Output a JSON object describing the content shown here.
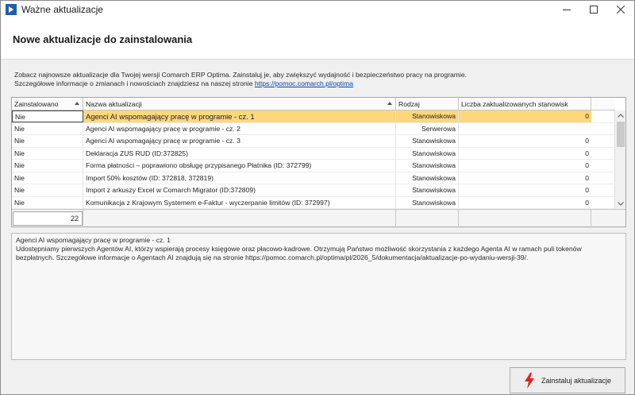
{
  "window": {
    "title": "Ważne aktualizacje",
    "controls": {
      "minimize": "minimize-icon",
      "maximize": "maximize-icon",
      "close": "close-icon"
    }
  },
  "header": {
    "title": "Nowe aktualizacje do zainstalowania"
  },
  "intro": {
    "line1": "Zobacz najnowsze aktualizacje dla Twojej wersji Comarch ERP Optima. Zainstaluj je, aby zwiększyć wydajność i bezpieczeństwo pracy na programie.",
    "line2_prefix": "Szczegółowe informacje o zmianach i nowościach znajdziesz na naszej stronie ",
    "link": "https://pomoc.comarch.pl/optima"
  },
  "grid": {
    "columns": [
      "Zainstalowano",
      "Nazwa aktualizacji",
      "Rodzaj",
      "Liczba zaktualizowanych stanowisk"
    ],
    "rows": [
      {
        "installed": "Nie",
        "name": "Agenci AI wspomagający pracę w programie - cz. 1",
        "type": "Stanowiskowa",
        "count": "0",
        "selected": true
      },
      {
        "installed": "Nie",
        "name": "Agenci AI wspomagający pracę w programie - cz. 2",
        "type": "Serwerowa",
        "count": ""
      },
      {
        "installed": "Nie",
        "name": "Agenci AI wspomagający pracę w programie - cz. 3",
        "type": "Stanowiskowa",
        "count": "0"
      },
      {
        "installed": "Nie",
        "name": "Deklaracja ZUS RUD (ID:372825)",
        "type": "Stanowiskowa",
        "count": "0"
      },
      {
        "installed": "Nie",
        "name": "Forma płatności – poprawiono obsługę przypisanego Płatnika (ID: 372799)",
        "type": "Stanowiskowa",
        "count": "0"
      },
      {
        "installed": "Nie",
        "name": "Import 50% kosztów (ID: 372818, 372819)",
        "type": "Stanowiskowa",
        "count": "0"
      },
      {
        "installed": "Nie",
        "name": "Import z arkuszy Excel w Comarch Migrator (ID:372809)",
        "type": "Stanowiskowa",
        "count": "0"
      },
      {
        "installed": "Nie",
        "name": "Komunikacja z Krajowym Systemem e-Faktur - wyczerpanie limitów (ID: 372997)",
        "type": "Stanowiskowa",
        "count": "0"
      }
    ],
    "total_count": "22"
  },
  "description": {
    "title": "Agenci AI wspomagający pracę w programie - cz. 1",
    "body": "Udostępniamy pierwszych Agentów AI, którzy wspierają procesy księgowe oraz płacowo-kadrowe. Otrzymują Państwo możliwość skorzystania z każdego Agenta AI w ramach puli tokenów bezpłatnych. Szczegółowe informacje o Agentach AI znajdują się na stronie https://pomoc.comarch.pl/optima/pl/2026_5/dokumentacja/aktualizacje-po-wydaniu-wersji-39/."
  },
  "footer": {
    "install_label": "Zainstaluj aktualizacje",
    "install_icon": "lightning-icon"
  },
  "colors": {
    "selected_row": "#fdd77b",
    "install_icon": "#e02424",
    "link": "#0645ad"
  }
}
